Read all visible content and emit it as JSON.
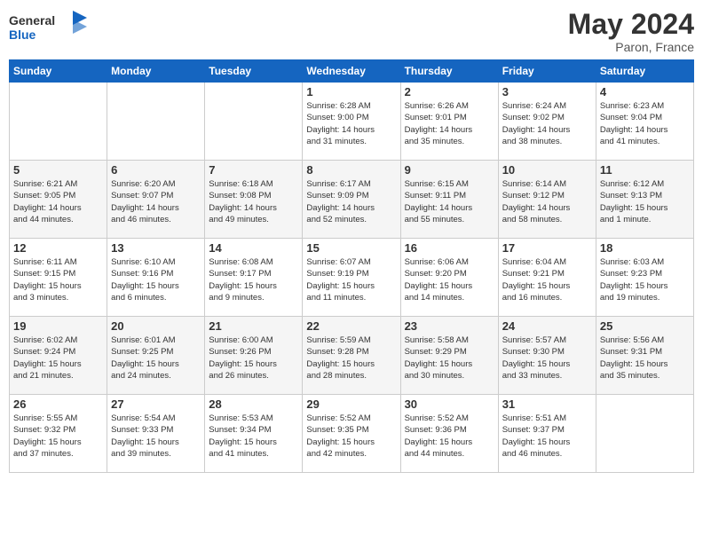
{
  "header": {
    "logo_line1": "General",
    "logo_line2": "Blue",
    "month_year": "May 2024",
    "location": "Paron, France"
  },
  "weekdays": [
    "Sunday",
    "Monday",
    "Tuesday",
    "Wednesday",
    "Thursday",
    "Friday",
    "Saturday"
  ],
  "weeks": [
    [
      {
        "day": "",
        "info": ""
      },
      {
        "day": "",
        "info": ""
      },
      {
        "day": "",
        "info": ""
      },
      {
        "day": "1",
        "info": "Sunrise: 6:28 AM\nSunset: 9:00 PM\nDaylight: 14 hours\nand 31 minutes."
      },
      {
        "day": "2",
        "info": "Sunrise: 6:26 AM\nSunset: 9:01 PM\nDaylight: 14 hours\nand 35 minutes."
      },
      {
        "day": "3",
        "info": "Sunrise: 6:24 AM\nSunset: 9:02 PM\nDaylight: 14 hours\nand 38 minutes."
      },
      {
        "day": "4",
        "info": "Sunrise: 6:23 AM\nSunset: 9:04 PM\nDaylight: 14 hours\nand 41 minutes."
      }
    ],
    [
      {
        "day": "5",
        "info": "Sunrise: 6:21 AM\nSunset: 9:05 PM\nDaylight: 14 hours\nand 44 minutes."
      },
      {
        "day": "6",
        "info": "Sunrise: 6:20 AM\nSunset: 9:07 PM\nDaylight: 14 hours\nand 46 minutes."
      },
      {
        "day": "7",
        "info": "Sunrise: 6:18 AM\nSunset: 9:08 PM\nDaylight: 14 hours\nand 49 minutes."
      },
      {
        "day": "8",
        "info": "Sunrise: 6:17 AM\nSunset: 9:09 PM\nDaylight: 14 hours\nand 52 minutes."
      },
      {
        "day": "9",
        "info": "Sunrise: 6:15 AM\nSunset: 9:11 PM\nDaylight: 14 hours\nand 55 minutes."
      },
      {
        "day": "10",
        "info": "Sunrise: 6:14 AM\nSunset: 9:12 PM\nDaylight: 14 hours\nand 58 minutes."
      },
      {
        "day": "11",
        "info": "Sunrise: 6:12 AM\nSunset: 9:13 PM\nDaylight: 15 hours\nand 1 minute."
      }
    ],
    [
      {
        "day": "12",
        "info": "Sunrise: 6:11 AM\nSunset: 9:15 PM\nDaylight: 15 hours\nand 3 minutes."
      },
      {
        "day": "13",
        "info": "Sunrise: 6:10 AM\nSunset: 9:16 PM\nDaylight: 15 hours\nand 6 minutes."
      },
      {
        "day": "14",
        "info": "Sunrise: 6:08 AM\nSunset: 9:17 PM\nDaylight: 15 hours\nand 9 minutes."
      },
      {
        "day": "15",
        "info": "Sunrise: 6:07 AM\nSunset: 9:19 PM\nDaylight: 15 hours\nand 11 minutes."
      },
      {
        "day": "16",
        "info": "Sunrise: 6:06 AM\nSunset: 9:20 PM\nDaylight: 15 hours\nand 14 minutes."
      },
      {
        "day": "17",
        "info": "Sunrise: 6:04 AM\nSunset: 9:21 PM\nDaylight: 15 hours\nand 16 minutes."
      },
      {
        "day": "18",
        "info": "Sunrise: 6:03 AM\nSunset: 9:23 PM\nDaylight: 15 hours\nand 19 minutes."
      }
    ],
    [
      {
        "day": "19",
        "info": "Sunrise: 6:02 AM\nSunset: 9:24 PM\nDaylight: 15 hours\nand 21 minutes."
      },
      {
        "day": "20",
        "info": "Sunrise: 6:01 AM\nSunset: 9:25 PM\nDaylight: 15 hours\nand 24 minutes."
      },
      {
        "day": "21",
        "info": "Sunrise: 6:00 AM\nSunset: 9:26 PM\nDaylight: 15 hours\nand 26 minutes."
      },
      {
        "day": "22",
        "info": "Sunrise: 5:59 AM\nSunset: 9:28 PM\nDaylight: 15 hours\nand 28 minutes."
      },
      {
        "day": "23",
        "info": "Sunrise: 5:58 AM\nSunset: 9:29 PM\nDaylight: 15 hours\nand 30 minutes."
      },
      {
        "day": "24",
        "info": "Sunrise: 5:57 AM\nSunset: 9:30 PM\nDaylight: 15 hours\nand 33 minutes."
      },
      {
        "day": "25",
        "info": "Sunrise: 5:56 AM\nSunset: 9:31 PM\nDaylight: 15 hours\nand 35 minutes."
      }
    ],
    [
      {
        "day": "26",
        "info": "Sunrise: 5:55 AM\nSunset: 9:32 PM\nDaylight: 15 hours\nand 37 minutes."
      },
      {
        "day": "27",
        "info": "Sunrise: 5:54 AM\nSunset: 9:33 PM\nDaylight: 15 hours\nand 39 minutes."
      },
      {
        "day": "28",
        "info": "Sunrise: 5:53 AM\nSunset: 9:34 PM\nDaylight: 15 hours\nand 41 minutes."
      },
      {
        "day": "29",
        "info": "Sunrise: 5:52 AM\nSunset: 9:35 PM\nDaylight: 15 hours\nand 42 minutes."
      },
      {
        "day": "30",
        "info": "Sunrise: 5:52 AM\nSunset: 9:36 PM\nDaylight: 15 hours\nand 44 minutes."
      },
      {
        "day": "31",
        "info": "Sunrise: 5:51 AM\nSunset: 9:37 PM\nDaylight: 15 hours\nand 46 minutes."
      },
      {
        "day": "",
        "info": ""
      }
    ]
  ]
}
